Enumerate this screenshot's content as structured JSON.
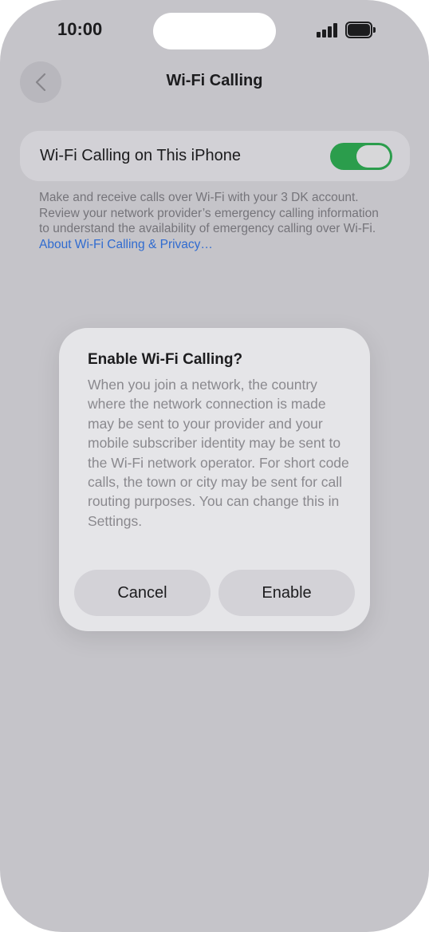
{
  "status_bar": {
    "time": "10:00"
  },
  "nav": {
    "title": "Wi-Fi Calling",
    "back_icon": "chevron-left-icon"
  },
  "toggle_row": {
    "label": "Wi-Fi Calling on This iPhone",
    "state": "on",
    "color": "#2b9d4c"
  },
  "footer": {
    "text": "Make and receive calls over Wi-Fi with your 3 DK account. Review your network provider’s emergency calling information to understand the availability of emergency calling over Wi-Fi. ",
    "link": "About Wi-Fi Calling & Privacy…"
  },
  "dialog": {
    "title": "Enable Wi-Fi Calling?",
    "message": "When you join a network, the country where the network connection is made may be sent to your provider and your mobile subscriber identity may be sent to the Wi-Fi network operator. For short code calls, the town or city may be sent for call routing purposes. You can change this in Settings.",
    "cancel_label": "Cancel",
    "enable_label": "Enable"
  },
  "colors": {
    "accent_link": "#2f6bd0",
    "background": "#c5c4c9"
  }
}
